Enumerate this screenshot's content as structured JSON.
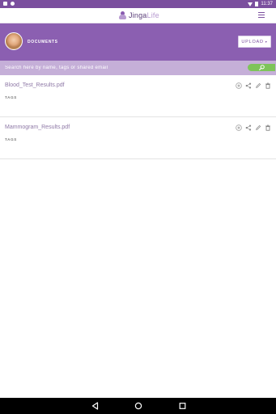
{
  "status_bar": {
    "time": "11:37"
  },
  "app": {
    "brand_primary": "Jinga",
    "brand_secondary": "Life"
  },
  "header": {
    "title": "DOCUMENTS",
    "upload_label": "UPLOAD"
  },
  "search": {
    "placeholder": "Search here by name, tags or shared email",
    "value": ""
  },
  "documents": [
    {
      "name": "Blood_Test_Results.pdf",
      "tags_label": "TAGS"
    },
    {
      "name": "Mammogram_Results.pdf",
      "tags_label": "TAGS"
    }
  ],
  "icons": {
    "menu": "hamburger-icon",
    "search": "search-icon",
    "doc_actions": [
      "info-icon",
      "share-icon",
      "edit-icon",
      "delete-icon"
    ],
    "nav": [
      "back-icon",
      "home-icon",
      "recent-apps-icon"
    ]
  },
  "colors": {
    "accent": "#8b5fb1",
    "search_bar": "#c5afd8",
    "search_button": "#7ec45a",
    "link": "#8e78a6"
  }
}
